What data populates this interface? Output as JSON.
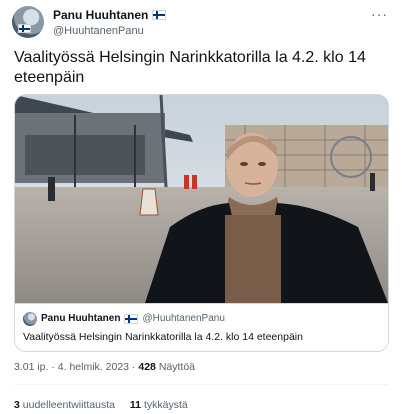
{
  "author": {
    "name": "Panu Huuhtanen",
    "handle": "@HuuhtanenPanu",
    "flag_icon": "finnish-flag-icon"
  },
  "more_icon": "more-icon",
  "more_glyph": "···",
  "tweet": {
    "text": "Vaalityössä Helsingin Narinkkatorilla la 4.2. klo 14 eteenpäin"
  },
  "media": {
    "description_icon": "video-thumbnail"
  },
  "quoted": {
    "name": "Panu Huuhtanen",
    "handle": "@HuuhtanenPanu",
    "text": "Vaalityössä Helsingin Narinkkatorilla la 4.2. klo 14 eteenpäin"
  },
  "meta": {
    "time": "3.01 ip.",
    "separator": "·",
    "date": "4. helmik. 2023",
    "views_count": "428",
    "views_label": "Näyttöä"
  },
  "stats": {
    "retweets_count": "3",
    "retweets_label": "uudelleentwiittausta",
    "likes_count": "11",
    "likes_label": "tykkäystä"
  },
  "colors": {
    "text": "#0f1419",
    "secondary": "#536471",
    "border": "#cfd9de",
    "flag_blue": "#003580"
  }
}
